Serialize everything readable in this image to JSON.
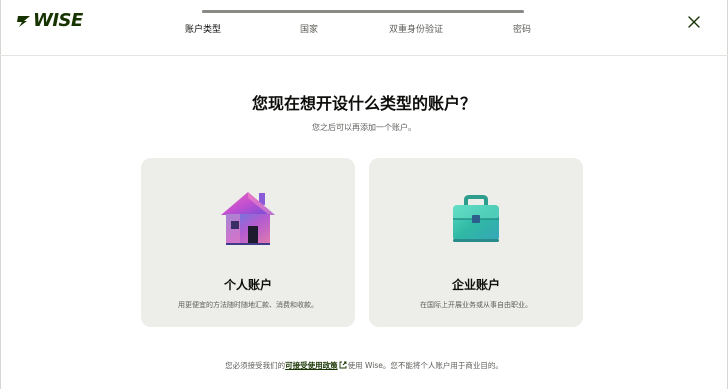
{
  "brand": {
    "logo_text": "WISE"
  },
  "stepper": {
    "progress": 1.0,
    "steps": [
      {
        "label": "账户类型",
        "active": true
      },
      {
        "label": "国家",
        "active": false
      },
      {
        "label": "双重身份验证",
        "active": false
      },
      {
        "label": "密码",
        "active": false
      }
    ]
  },
  "main": {
    "title": "您现在想开设什么类型的账户？",
    "subtitle": "您之后可以再添加一个账户。"
  },
  "cards": {
    "personal": {
      "title": "个人账户",
      "description": "用更便宜的方法随时随地汇款、消费和收款。",
      "icon": "house-icon"
    },
    "business": {
      "title": "企业账户",
      "description": "在国际上开展业务或从事自由职业。",
      "icon": "briefcase-icon"
    }
  },
  "footer": {
    "prefix": "您必须接受我们的",
    "link_label": "可接受使用政策",
    "suffix": "使用 Wise。您不能将个人账户用于商业目的。"
  },
  "colors": {
    "brand": "#163300",
    "card_bg": "#edeee9",
    "muted_text": "#5d5f5a"
  }
}
